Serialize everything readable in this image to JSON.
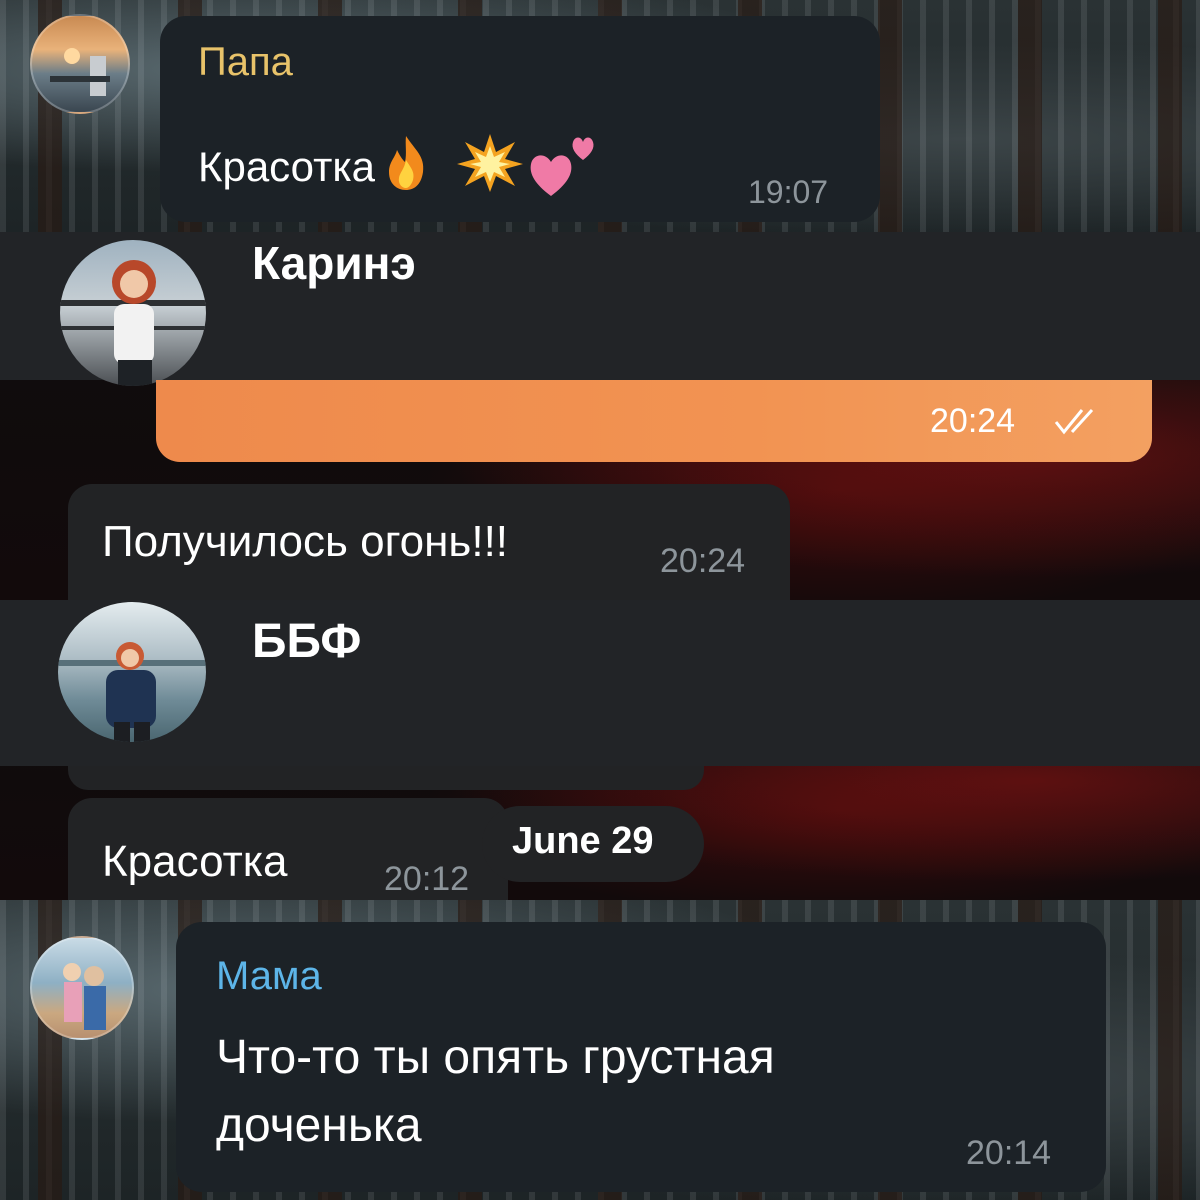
{
  "chat1": {
    "sender": "Папа",
    "message": "Красотка",
    "time": "19:07",
    "sender_color": "#e8c36a"
  },
  "chat2": {
    "header_name": "Каринэ",
    "outgoing_time": "20:24",
    "incoming_message": "Получилось огонь!!!",
    "incoming_time": "20:24",
    "accent_color": "#ee8a4c"
  },
  "chat3": {
    "header_name": "ББФ",
    "message": "Красотка",
    "time": "20:12",
    "date_chip": "June 29"
  },
  "chat4": {
    "sender": "Мама",
    "message_line1": "Что-то ты опять грустная",
    "message_line2": "доченька",
    "time": "20:14",
    "sender_color": "#5db5e8"
  }
}
